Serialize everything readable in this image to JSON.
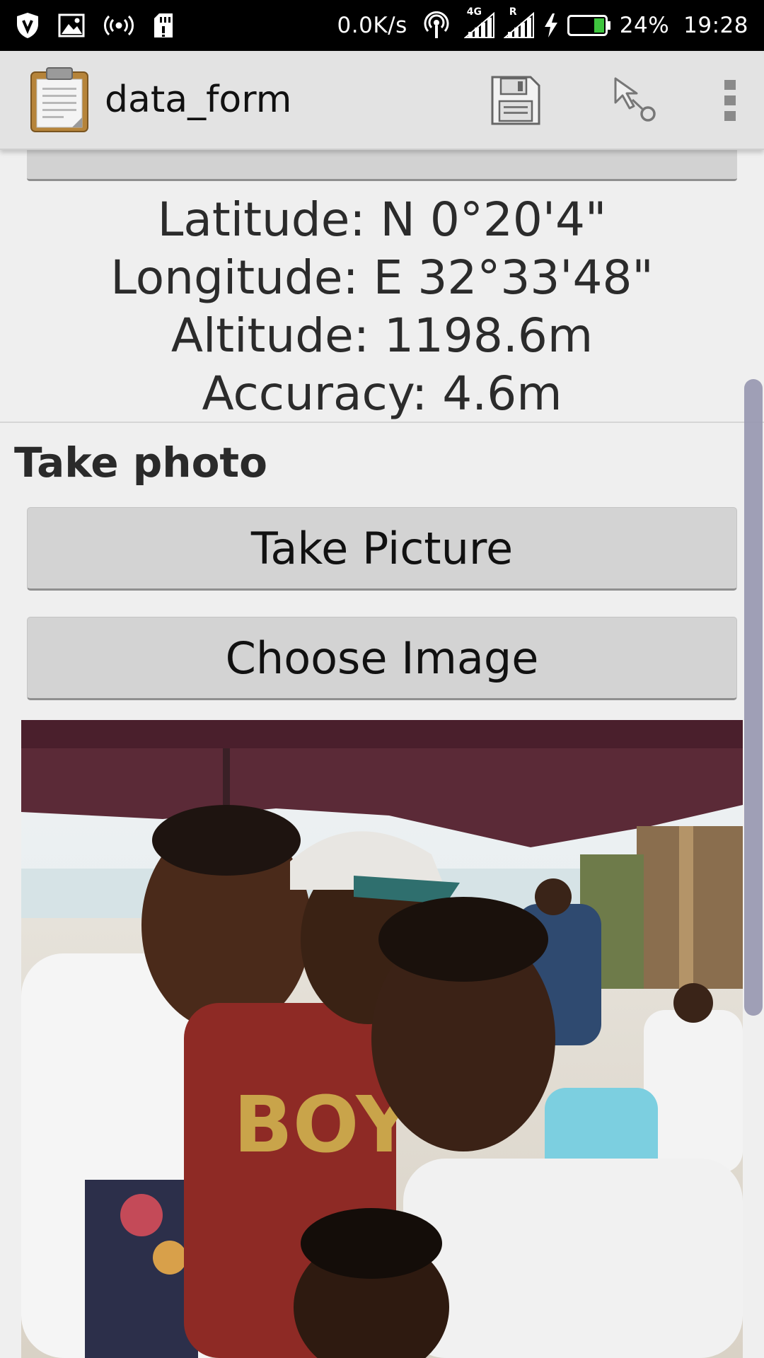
{
  "status_bar": {
    "net_speed": "0.0K/s",
    "network_4g": "4G",
    "roaming": "R",
    "battery": "24%",
    "time": "19:28",
    "icons": [
      "shield-icon",
      "image-icon",
      "broadcast-icon",
      "sd-card-icon",
      "hotspot-icon",
      "signal-icon",
      "signal-icon",
      "charging-icon",
      "battery-icon"
    ]
  },
  "action_bar": {
    "title": "data_form",
    "icons": [
      "clipboard-icon",
      "save-icon",
      "go-to-icon",
      "more-vert-icon"
    ]
  },
  "geo": {
    "latitude": "Latitude: N 0°20'4\"",
    "longitude": "Longitude: E 32°33'48\"",
    "altitude": "Altitude: 1198.6m",
    "accuracy": "Accuracy: 4.6m"
  },
  "photo_question": {
    "label": "Take photo",
    "take_picture": "Take Picture",
    "choose_image": "Choose Image"
  },
  "colors": {
    "status_bar_bg": "#000000",
    "action_bar_bg": "#e3e3e3",
    "content_bg": "#efefef",
    "button_bg": "#d3d3d3",
    "battery_fill": "#3ec43e",
    "scrollbar": "#9a9ab2"
  }
}
